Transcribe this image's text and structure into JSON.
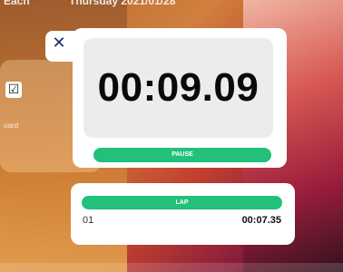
{
  "header": {
    "left_text": "Each",
    "datetime": "Thursday 2021/01/28"
  },
  "background_card": {
    "label": "oard",
    "icon": "checkbox-icon"
  },
  "stopwatch": {
    "close_icon": "close-icon",
    "time": "00:09.09",
    "pause_label": "PAUSE",
    "lap_label": "LAP",
    "laps": [
      {
        "index": "01",
        "time": "00:07.35"
      }
    ]
  },
  "colors": {
    "accent_green": "#22c07a",
    "close_icon_blue": "#1b2c6b"
  }
}
